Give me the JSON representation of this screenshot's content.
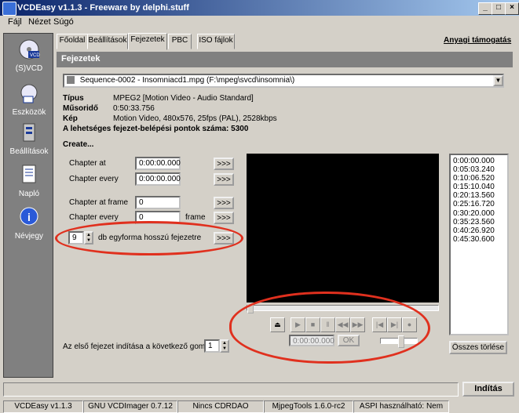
{
  "window": {
    "title": "VCDEasy v1.1.3 - Freeware by delphi.stuff",
    "min": "_",
    "max": "□",
    "close": "×"
  },
  "menu": [
    "Fájl",
    "Nézet",
    "Súgó"
  ],
  "sidebar": [
    {
      "label": "(S)VCD",
      "icon": "disc-icon"
    },
    {
      "label": "Eszközök",
      "icon": "tools-icon"
    },
    {
      "label": "Beállítások",
      "icon": "settings-icon"
    },
    {
      "label": "Napló",
      "icon": "log-icon"
    },
    {
      "label": "Névjegy",
      "icon": "info-icon"
    }
  ],
  "tabs": [
    "Főoldal",
    "Beállítások",
    "Fejezetek",
    "PBC",
    "ISO fájlok"
  ],
  "support_link": "Anyagi támogatás",
  "section_title": "Fejezetek",
  "sequence": "Sequence-0002 - Insomniacd1.mpg  (F:\\mpeg\\svcd\\insomnia\\)",
  "info": {
    "type_label": "Típus",
    "type_value": "MPEG2  [Motion Video - Audio Standard]",
    "duration_label": "Műsoridő",
    "duration_value": "0:50:33.756",
    "image_label": "Kép",
    "image_value": "Motion Video, 480x576, 25fps (PAL), 2528kbps",
    "entry_points": "A lehetséges fejezet-belépési pontok száma: 5300"
  },
  "create_label": "Create...",
  "chapter": {
    "at_label": "Chapter at",
    "at_value": "0:00:00.000",
    "every_label": "Chapter every",
    "every_value": "0:00:00.000",
    "at_frame_label": "Chapter at frame",
    "at_frame_value": "0",
    "every_frame_label": "Chapter every",
    "every_frame_value": "0",
    "frame_suffix": "frame",
    "equal_count": "9",
    "equal_label": "db egyforma hosszú fejezetre",
    "go": ">>>"
  },
  "chapters_list": [
    "0:00:00.000",
    "0:05:03.240",
    "0:10:06.520",
    "0:15:10.040",
    "0:20:13.560",
    "0:25:16.720",
    "0:30:20.000",
    "0:35:23.560",
    "0:40:26.920",
    "0:45:30.600"
  ],
  "player": {
    "time_value": "0:00:00.000",
    "ok": "OK"
  },
  "first_chapter_label": "Az első fejezet indítása a következő gombbal",
  "first_chapter_value": "1",
  "clear_all": "Összes törlése",
  "start": "Indítás",
  "status": [
    "VCDEasy v1.1.3",
    "GNU VCDImager 0.7.12",
    "Nincs CDRDAO",
    "MjpegTools 1.6.0-rc2",
    "ASPI használható: Nem"
  ],
  "colors": {
    "annotation": "#e0301e",
    "titlebar": "#0a246a"
  }
}
